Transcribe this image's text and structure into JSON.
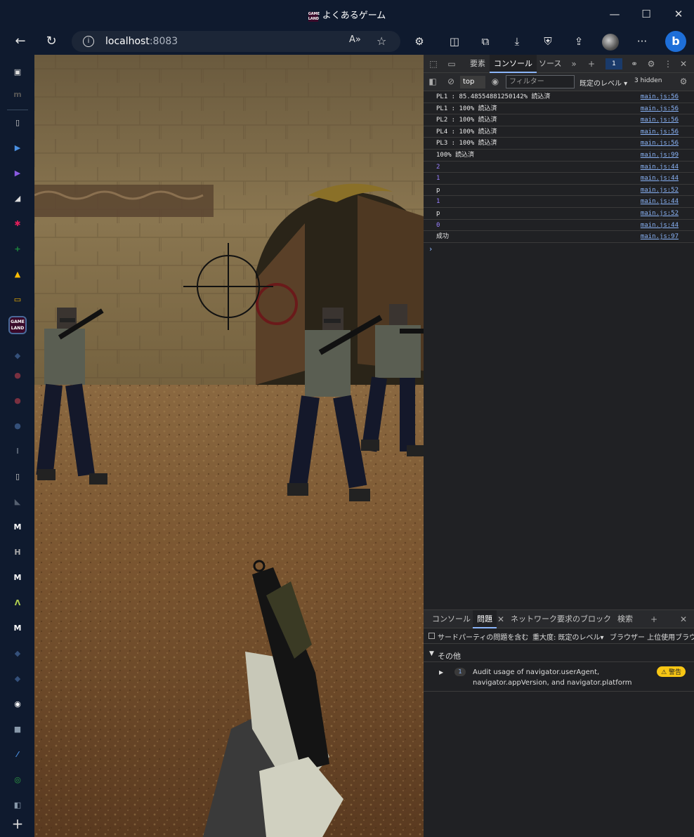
{
  "window": {
    "title": "よくあるゲーム",
    "favicon_text": "GAME LAND",
    "minimize_glyph": "—",
    "maximize_glyph": "☐",
    "close_glyph": "✕"
  },
  "addressbar": {
    "host": "localhost",
    "port": ":8083",
    "read_aloud_glyph": "A»",
    "favorite_glyph": "☆"
  },
  "toolbar_glyphs": {
    "back": "←",
    "reload": "↻",
    "info": "i",
    "extensions": "⚙",
    "split": "◫",
    "collections": "⧉",
    "downloads": "⤓",
    "security": "⛨",
    "share": "⇪",
    "more": "···",
    "bing": "b"
  },
  "sidebar": {
    "game_land_text": "GAME LAND",
    "add_glyph": "+",
    "items": [
      {
        "name": "tab-actions",
        "glyph": "▣",
        "color": "#dddddd"
      },
      {
        "name": "m-logo",
        "glyph": "m",
        "color": "#555555"
      },
      {
        "name": "page",
        "glyph": "▯",
        "color": "#cfcfcf"
      },
      {
        "name": "arrow-blue",
        "glyph": "▶",
        "color": "#4a90e2"
      },
      {
        "name": "arrow-purple",
        "glyph": "▶",
        "color": "#8a5ae2"
      },
      {
        "name": "notion",
        "glyph": "◢",
        "color": "#dddddd"
      },
      {
        "name": "slack",
        "glyph": "✱",
        "color": "#e01e5a"
      },
      {
        "name": "sheets-plus",
        "glyph": "+",
        "color": "#1e8e3e"
      },
      {
        "name": "drive",
        "glyph": "▲",
        "color": "#fbbc04"
      },
      {
        "name": "slides",
        "glyph": "▭",
        "color": "#f4b400"
      },
      {
        "name": "gameland",
        "glyph": "GL",
        "color": "#3a0a2a"
      },
      {
        "name": "faded-1",
        "glyph": "◆",
        "color": "#34507a"
      },
      {
        "name": "faded-red-1",
        "glyph": "●",
        "color": "#7a3040"
      },
      {
        "name": "faded-red-2",
        "glyph": "●",
        "color": "#7a3040"
      },
      {
        "name": "faded-blue",
        "glyph": "●",
        "color": "#34507a"
      },
      {
        "name": "faded-i",
        "glyph": "I",
        "color": "#556070"
      },
      {
        "name": "page-2",
        "glyph": "▯",
        "color": "#cfcfcf"
      },
      {
        "name": "triangle",
        "glyph": "◣",
        "color": "#556070"
      },
      {
        "name": "m-1",
        "glyph": "M",
        "color": "#ffffff"
      },
      {
        "name": "h",
        "glyph": "H",
        "color": "#aaaaaa"
      },
      {
        "name": "m-2",
        "glyph": "M",
        "color": "#ffffff"
      },
      {
        "name": "lambda",
        "glyph": "Λ",
        "color": "#b0d050"
      },
      {
        "name": "m-3",
        "glyph": "M",
        "color": "#ffffff"
      },
      {
        "name": "faded-2",
        "glyph": "◆",
        "color": "#34507a"
      },
      {
        "name": "faded-3",
        "glyph": "◆",
        "color": "#34507a"
      },
      {
        "name": "github",
        "glyph": "◉",
        "color": "#ffffff"
      },
      {
        "name": "square",
        "glyph": "■",
        "color": "#8899aa"
      },
      {
        "name": "slash",
        "glyph": "⁄",
        "color": "#4a90e2"
      },
      {
        "name": "green-circle",
        "glyph": "◎",
        "color": "#2ea043"
      },
      {
        "name": "cube",
        "glyph": "◧",
        "color": "#8899aa"
      }
    ]
  },
  "devtools": {
    "tabs": {
      "elements": "要素",
      "console": "コンソール",
      "sources": "ソース"
    },
    "message_badge": "1",
    "context": "top",
    "filter_placeholder": "フィルター",
    "level": "既定のレベル ▾",
    "hidden": "3 hidden",
    "prompt": "›",
    "logs": [
      {
        "msg": "PL1 : 85.48554881250142% 読込済",
        "src": "main.js:56",
        "num": false
      },
      {
        "msg": "PL1 : 100% 読込済",
        "src": "main.js:56",
        "num": false
      },
      {
        "msg": "PL2 : 100% 読込済",
        "src": "main.js:56",
        "num": false
      },
      {
        "msg": "PL4 : 100% 読込済",
        "src": "main.js:56",
        "num": false
      },
      {
        "msg": "PL3 : 100% 読込済",
        "src": "main.js:56",
        "num": false
      },
      {
        "msg": "100% 読込済",
        "src": "main.js:99",
        "num": false
      },
      {
        "msg": "2",
        "src": "main.js:44",
        "num": true
      },
      {
        "msg": "1",
        "src": "main.js:44",
        "num": true
      },
      {
        "msg": "p",
        "src": "main.js:52",
        "num": false
      },
      {
        "msg": "1",
        "src": "main.js:44",
        "num": true
      },
      {
        "msg": "p",
        "src": "main.js:52",
        "num": false
      },
      {
        "msg": "0",
        "src": "main.js:44",
        "num": true
      },
      {
        "msg": "成功",
        "src": "main.js:97",
        "num": false
      }
    ],
    "drawer": {
      "tabs": {
        "console": "コンソール",
        "issues": "問題",
        "network_block": "ネットワーク要求のブロック",
        "search": "検索"
      },
      "third_party": "サードパーティの問題を含む",
      "severity": "重大度: 既定のレベル▾",
      "browser": "ブラウザー 上位使用ブラウ",
      "section": "その他",
      "issue_count": "1",
      "issue_line1": "Audit usage of navigator.userAgent,",
      "issue_line2": "navigator.appVersion, and navigator.platform",
      "warning": "⚠ 警告"
    }
  }
}
